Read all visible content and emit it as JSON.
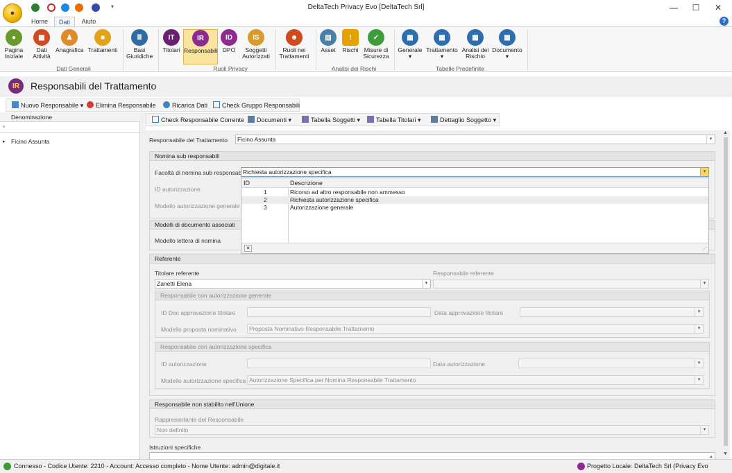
{
  "window": {
    "title": "DeltaTech Privacy Evo [DeltaTech Srl]",
    "minimize": "—",
    "maximize": "☐",
    "close": "✕"
  },
  "help_icon": "?",
  "tabs": [
    "Home",
    "Dati",
    "Aiuto"
  ],
  "ribbon": {
    "buttons": [
      "Pagina\nIniziale",
      "Dati\nAttività",
      "Anagrafica",
      "Trattamenti",
      "Basi\nGiuridiche",
      "Titolari",
      "Responsabili",
      "DPO",
      "Soggetti\nAutorizzati",
      "Ruoli nei\nTrattamenti",
      "Asset",
      "Rischi",
      "Misure di\nSicurezza",
      "Generale",
      "Trattamento",
      "Analisi dei\nRischio",
      "Documento"
    ],
    "groups": [
      "Dati Generali",
      "Ruoli Privacy",
      "Analisi dei Rischi",
      "Tabelle Predefinite"
    ]
  },
  "page_title": "Responsabili del Trattamento",
  "toolbar1": [
    "Nuovo Responsabile",
    "Elimina Responsabile",
    "Ricarica Dati",
    "Check Gruppo Responsabili"
  ],
  "toolbar2": [
    "Check Responsabile Corrente",
    "Documenti",
    "Tabella Soggetti",
    "Tabella Titolari",
    "Dettaglio Soggetto"
  ],
  "grid": {
    "header": "Denominazione",
    "rows": [
      "Ficino Assunta"
    ]
  },
  "form": {
    "responsabile_label": "Responsabile del Trattamento",
    "responsabile_value": "Ficino Assunta",
    "nomina": {
      "title": "Nomina sub responsabili",
      "facolta_label": "Facoltà di nomina sub responsabili",
      "facolta_value": "Richiesta autorizzazione specifica",
      "id_aut_label": "ID autorizzazione",
      "modello_gen_label": "Modello autorizzazione generale"
    },
    "modelli": {
      "title": "Modelli di documento associati",
      "lettera_label": "Modello lettera di nomina"
    },
    "referente": {
      "title": "Referente",
      "titolare_label": "Titolare referente",
      "titolare_value": "Zanetti Elena",
      "resp_ref_label": "Responsabile referente",
      "gen": {
        "title": "Responsabile con autorizzazione generale",
        "id_doc_label": "ID Doc approvazione titolare",
        "data_label": "Data approvazione titolare",
        "modello_label": "Modello proposta nominativo",
        "modello_value": "Proposta Nominativo Responsabile Trattamento"
      },
      "spec": {
        "title": "Responsabile con autorizzazione specifica",
        "id_label": "ID autorizzazione",
        "data_label": "Data autorizzazione",
        "modello_label": "Modello autorizzazione specifica",
        "modello_value": "Autorizzazione Specifica per Nomina Responsabile Trattamento"
      }
    },
    "unione": {
      "title": "Responsabile non stabilito nell'Unione",
      "rapp_label": "Rappresentante del Responsabile",
      "rapp_value": "Non definito"
    },
    "istruzioni_label": "Istruzioni specifiche"
  },
  "popup": {
    "headers": [
      "ID",
      "Descrizione"
    ],
    "rows": [
      {
        "id": "1",
        "desc": "Ricorso ad altro responsabile non ammesso"
      },
      {
        "id": "2",
        "desc": "Richiesta autorizzazione specifica"
      },
      {
        "id": "3",
        "desc": "Autorizzazione generale"
      }
    ],
    "selected": 1,
    "clear": "✕"
  },
  "status": {
    "left": "Connesso - Codice Utente: 2210 - Account: Accesso completo - Nome Utente: admin@digitale.it",
    "right": "Progetto Locale: DeltaTech Srl (Privacy Evo Ultimate)"
  },
  "colors": {
    "accent": "#2b5797",
    "selected_ribbon": "#fbe3a0",
    "panel": "#f0f0f0"
  }
}
